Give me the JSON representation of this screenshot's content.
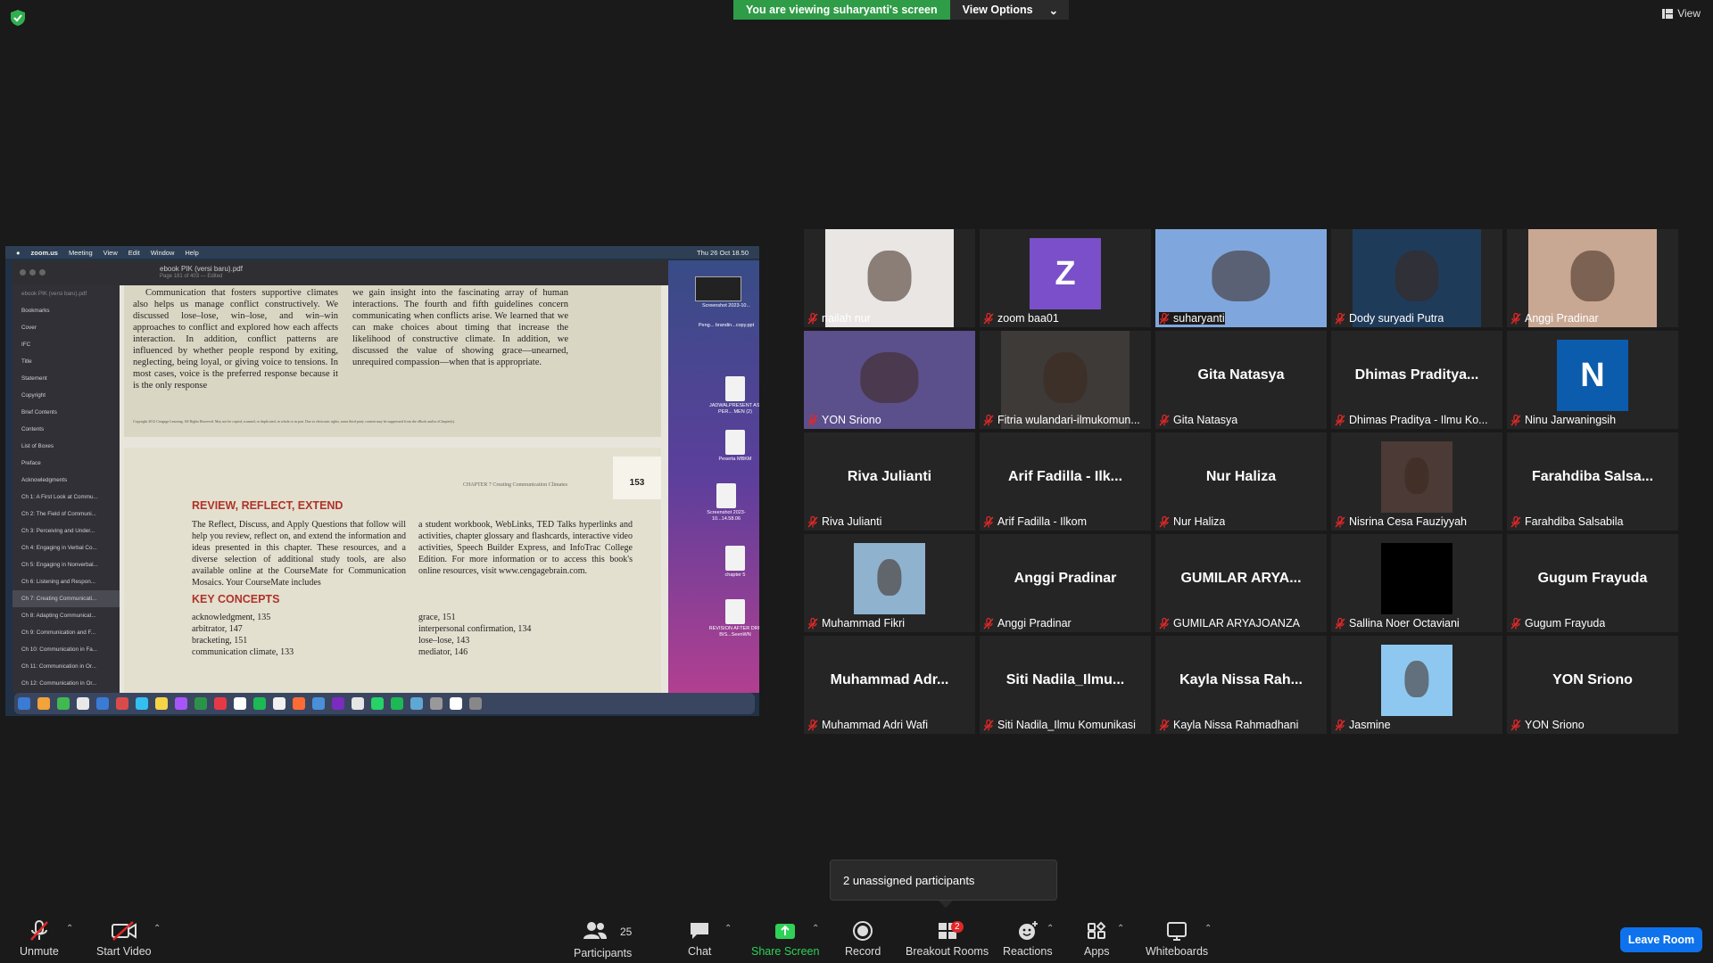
{
  "top": {
    "banner": "You are viewing suharyanti's screen",
    "view_options": "View Options",
    "view": "View"
  },
  "shared_screen": {
    "menubar": {
      "app": "zoom.us",
      "items": [
        "Meeting",
        "View",
        "Edit",
        "Window",
        "Help"
      ],
      "clock": "Thu 26 Oct 18.50"
    },
    "pdf_title": "ebook PIK (versi baru).pdf",
    "pdf_subtitle": "Page 181 of 403 — Edited",
    "sidebar_items": [
      "ebook PIK (versi baru).pdf",
      "Bookmarks",
      "Cover",
      "IFC",
      "Title",
      "Statement",
      "Copyright",
      "Brief Contents",
      "Contents",
      "List of Boxes",
      "Preface",
      "Acknowledgments",
      "Ch 1: A First Look at Commu...",
      "Ch 2: The Field of Communi...",
      "Ch 3: Perceiving and Under...",
      "Ch 4: Engaging in Verbal Co...",
      "Ch 5: Engaging in Nonverbal...",
      "Ch 6: Listening and Respon...",
      "Ch 7: Creating Communicati...",
      "Ch 8: Adapting Communicat...",
      "Ch 9: Communication and F...",
      "Ch 10: Communication in Fa...",
      "Ch 11: Communication in Or...",
      "Ch 12: Communication in Or..."
    ],
    "page1_left": "Communication that fosters supportive climates also helps us manage conflict constructively. We discussed lose–lose, win–lose, and win–win approaches to conflict and explored how each affects interaction. In addition, conflict patterns are influenced by whether people respond by exiting, neglecting, being loyal, or giving voice to tensions. In most cases, voice is the preferred response because it is the only response",
    "page1_right": "we gain insight into the fascinating array of human interactions. The fourth and fifth guidelines concern communicating when conflicts arise. We learned that we can make choices about timing that increase the likelihood of constructive climate. In addition, we discussed the value of showing grace—unearned, unrequired compassion—when that is appropriate.",
    "copyright": "Copyright 2012 Cengage Learning. All Rights Reserved. May not be copied, scanned, or duplicated, in whole or in part. Due to electronic rights, some third party content may be suppressed from the eBook and/or eChapter(s).",
    "chapter_header": "CHAPTER 7   Creating Communication Climates",
    "page_number": "153",
    "review_heading": "REVIEW, REFLECT, EXTEND",
    "review_left": "The Reflect, Discuss, and Apply Questions that follow will help you review, reflect on, and extend the information and ideas presented in this chapter. These resources, and a diverse selection of additional study tools, are also available online at the CourseMate for Communication Mosaics. Your CourseMate includes",
    "review_right": "a student workbook, WebLinks, TED Talks hyperlinks and activities, chapter glossary and flashcards, interactive video activities, Speech Builder Express, and InfoTrac College Edition. For more information or to access this book's online resources, visit www.cengagebrain.com.",
    "key_heading": "KEY CONCEPTS",
    "key_left": [
      "acknowledgment, 135",
      "arbitrator, 147",
      "bracketing, 151",
      "communication climate, 133"
    ],
    "key_right": [
      "grace, 151",
      "interpersonal confirmation, 134",
      "lose–lose, 143",
      "mediator, 146"
    ],
    "desktop_files": [
      "Screenshot 2023-10...",
      "Peng... brandin...copy.ppt",
      "JADWALPRESENT ASI PER... MEN (2)",
      "Peserta MBKM",
      "Screenshot 2023-10...14.58.06",
      "chapter 5",
      "REVISION AFTER DRP BIS...SeenWN"
    ]
  },
  "participants": [
    {
      "big": "",
      "label": "nailah nur",
      "kind": "video",
      "color": "#e9e6e4"
    },
    {
      "big": "",
      "label": "zoom baa01",
      "kind": "avatar",
      "initial": "Z",
      "color": "#7a4fc9"
    },
    {
      "big": "",
      "label": "suharyanti",
      "kind": "video",
      "color": "#7fa7dd",
      "active": true
    },
    {
      "big": "",
      "label": "Dody suryadi Putra",
      "kind": "video",
      "color": "#1f3b5a"
    },
    {
      "big": "",
      "label": "Anggi Pradinar",
      "kind": "video",
      "color": "#c9a893"
    },
    {
      "big": "",
      "label": "YON Sriono",
      "kind": "video",
      "color": "#5b4f8c"
    },
    {
      "big": "",
      "label": "Fitria wulandari-ilmukomun...",
      "kind": "video",
      "color": "#3e3a38"
    },
    {
      "big": "Gita Natasya",
      "label": "Gita Natasya",
      "kind": "name"
    },
    {
      "big": "Dhimas  Praditya...",
      "label": "Dhimas Praditya - Ilmu Ko...",
      "kind": "name"
    },
    {
      "big": "",
      "label": "Ninu Jarwaningsih",
      "kind": "avatar",
      "initial": "N",
      "color": "#0b5cad"
    },
    {
      "big": "Riva Julianti",
      "label": "Riva Julianti",
      "kind": "name"
    },
    {
      "big": "Arif Fadilla - Ilk...",
      "label": "Arif Fadilla - Ilkom",
      "kind": "name"
    },
    {
      "big": "Nur Haliza",
      "label": "Nur Haliza",
      "kind": "name"
    },
    {
      "big": "",
      "label": "Nisrina Cesa Fauziyyah",
      "kind": "photo",
      "color": "#4b3a35"
    },
    {
      "big": "Farahdiba  Salsa...",
      "label": "Farahdiba Salsabila",
      "kind": "name"
    },
    {
      "big": "",
      "label": "Muhammad Fikri",
      "kind": "photo",
      "color": "#8fb2cf"
    },
    {
      "big": "Anggi Pradinar",
      "label": "Anggi Pradinar",
      "kind": "name"
    },
    {
      "big": "GUMILAR  ARYA...",
      "label": "GUMILAR ARYAJOANZA",
      "kind": "name"
    },
    {
      "big": "",
      "label": "Sallina Noer Octaviani",
      "kind": "photo",
      "color": "#000000"
    },
    {
      "big": "Gugum Frayuda",
      "label": "Gugum Frayuda",
      "kind": "name"
    },
    {
      "big": "Muhammad  Adr...",
      "label": "Muhammad Adri Wafi",
      "kind": "name"
    },
    {
      "big": "Siti  Nadila_Ilmu...",
      "label": "Siti Nadila_Ilmu Komunikasi",
      "kind": "name"
    },
    {
      "big": "Kayla  Nissa  Rah...",
      "label": "Kayla Nissa Rahmadhani",
      "kind": "name"
    },
    {
      "big": "",
      "label": "Jasmine",
      "kind": "photo",
      "color": "#8ec8f0"
    },
    {
      "big": "YON Sriono",
      "label": "YON Sriono",
      "kind": "name"
    }
  ],
  "popup": "2 unassigned participants",
  "toolbar": {
    "unmute": "Unmute",
    "start_video": "Start Video",
    "participants": "Participants",
    "participants_count": "25",
    "chat": "Chat",
    "share_screen": "Share Screen",
    "record": "Record",
    "breakout": "Breakout Rooms",
    "breakout_badge": "2",
    "reactions": "Reactions",
    "apps": "Apps",
    "whiteboards": "Whiteboards",
    "leave": "Leave Room"
  },
  "colors": {
    "banner_green": "#2f9c47",
    "accent_blue": "#0e72ed",
    "active_border": "#e8d64a",
    "mute_red": "#e02828"
  }
}
